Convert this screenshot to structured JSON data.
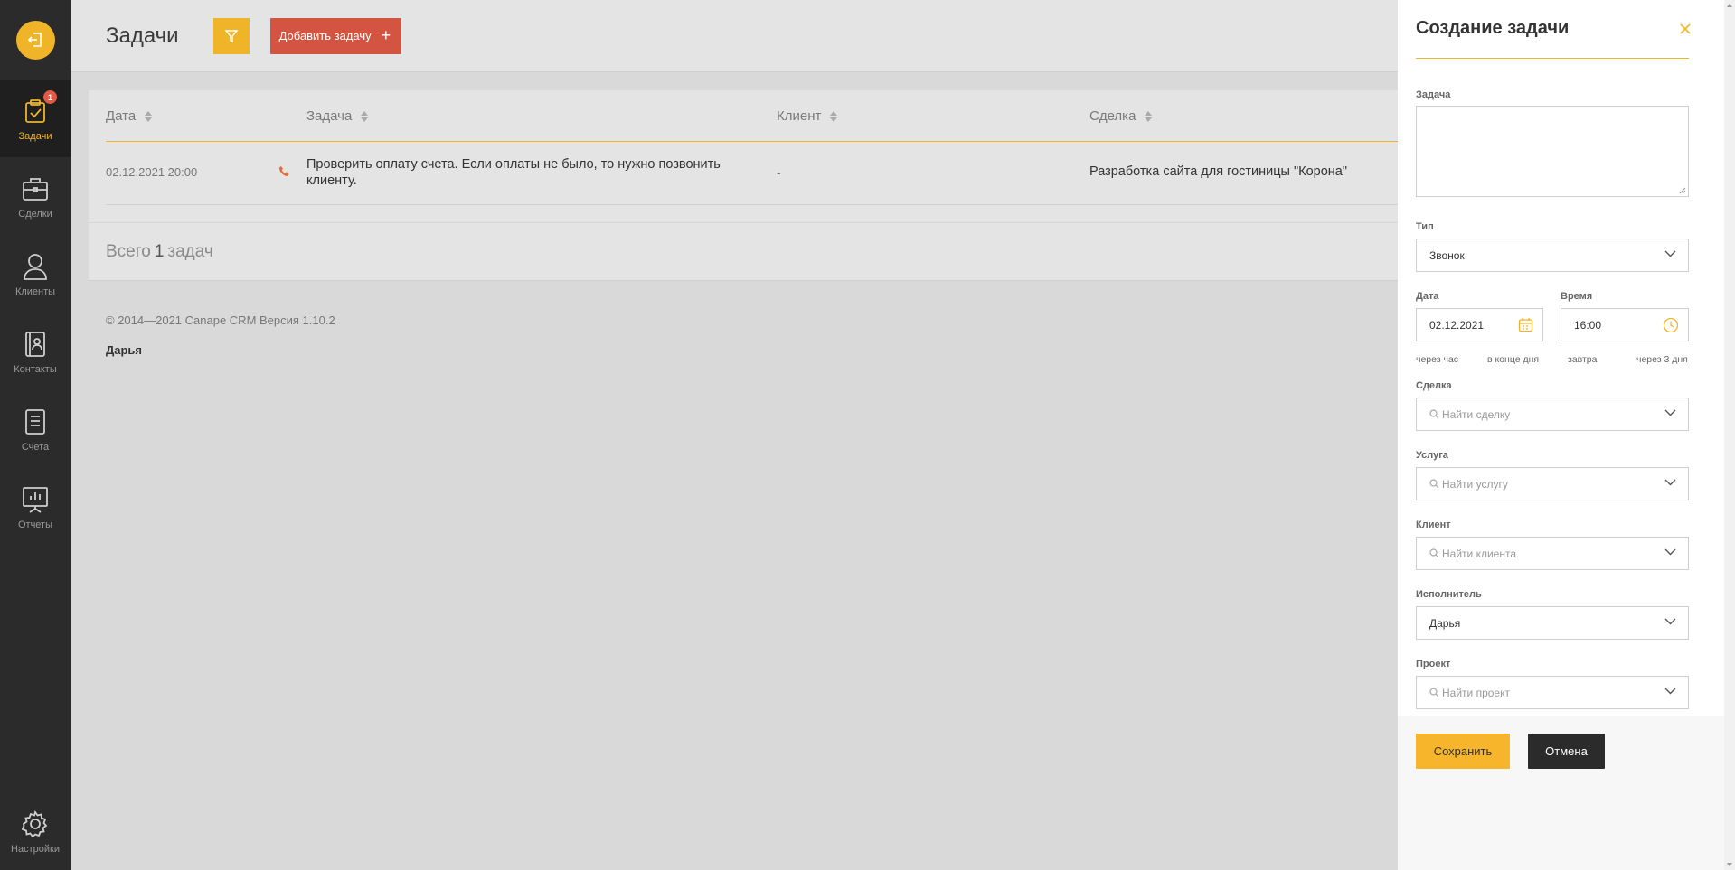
{
  "sidebar": {
    "items": [
      {
        "label": "Задачи",
        "icon": "clipboard-check-icon",
        "badge": "1",
        "active": true
      },
      {
        "label": "Сделки",
        "icon": "briefcase-icon"
      },
      {
        "label": "Клиенты",
        "icon": "user-icon"
      },
      {
        "label": "Контакты",
        "icon": "contact-book-icon"
      },
      {
        "label": "Счета",
        "icon": "invoice-icon"
      },
      {
        "label": "Отчеты",
        "icon": "report-board-icon"
      }
    ],
    "settings_label": "Настройки"
  },
  "header": {
    "title": "Задачи",
    "add_label": "Добавить задачу"
  },
  "table": {
    "columns": [
      "Дата",
      "Задача",
      "Клиент",
      "Сделка"
    ],
    "rows": [
      {
        "date": "02.12.2021 20:00",
        "task": "Проверить оплату счета. Если оплаты не было, то нужно позвонить клиенту.",
        "client": "-",
        "deal": "Разработка сайта для гостиницы \"Корона\""
      }
    ]
  },
  "summary": {
    "prefix": "Всего",
    "count": "1",
    "suffix": "задач"
  },
  "footer": {
    "copyright": "© 2014—2021 Canape CRM Версия 1.10.2",
    "user": "Дарья"
  },
  "drawer": {
    "title": "Создание задачи",
    "task_label": "Задача",
    "type_label": "Тип",
    "type_value": "Звонок",
    "date_label": "Дата",
    "date_value": "02.12.2021",
    "time_label": "Время",
    "time_value": "16:00",
    "quick": [
      "через час",
      "в конце дня",
      "завтра",
      "через 3 дня"
    ],
    "deal_label": "Сделка",
    "deal_placeholder": "Найти сделку",
    "service_label": "Услуга",
    "service_placeholder": "Найти услугу",
    "client_label": "Клиент",
    "client_placeholder": "Найти клиента",
    "assignee_label": "Исполнитель",
    "assignee_value": "Дарья",
    "project_label": "Проект",
    "project_placeholder": "Найти проект",
    "save_label": "Сохранить",
    "cancel_label": "Отмена"
  },
  "colors": {
    "accent": "#f0b429",
    "danger": "#d35440",
    "sidebar": "#2b2b2b"
  }
}
